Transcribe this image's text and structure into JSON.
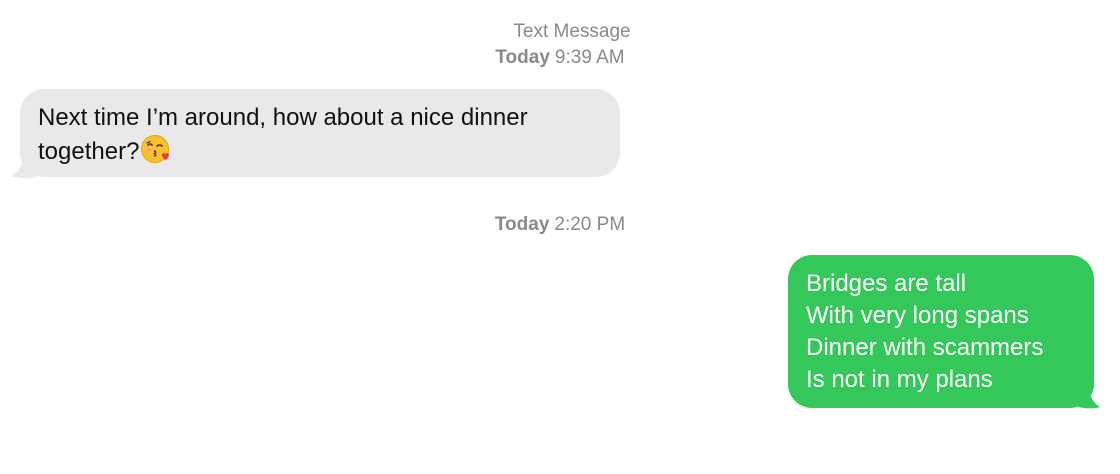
{
  "thread": {
    "service_label": "Text Message",
    "stamps": [
      {
        "day": "Today",
        "time": "9:39 AM"
      },
      {
        "day": "Today",
        "time": "2:20 PM"
      }
    ]
  },
  "messages": [
    {
      "direction": "incoming",
      "lines": [
        "Next time I’m around, how about a nice dinner",
        "together?"
      ],
      "emoji": "face-blowing-a-kiss-icon"
    },
    {
      "direction": "outgoing",
      "lines": [
        "Bridges are tall",
        "With very long spans",
        "Dinner with scammers",
        "Is not in my plans"
      ]
    }
  ],
  "colors": {
    "incoming_bubble": "#e9e9eb",
    "outgoing_bubble": "#34c759",
    "timestamp_text": "#8a8a8e"
  }
}
